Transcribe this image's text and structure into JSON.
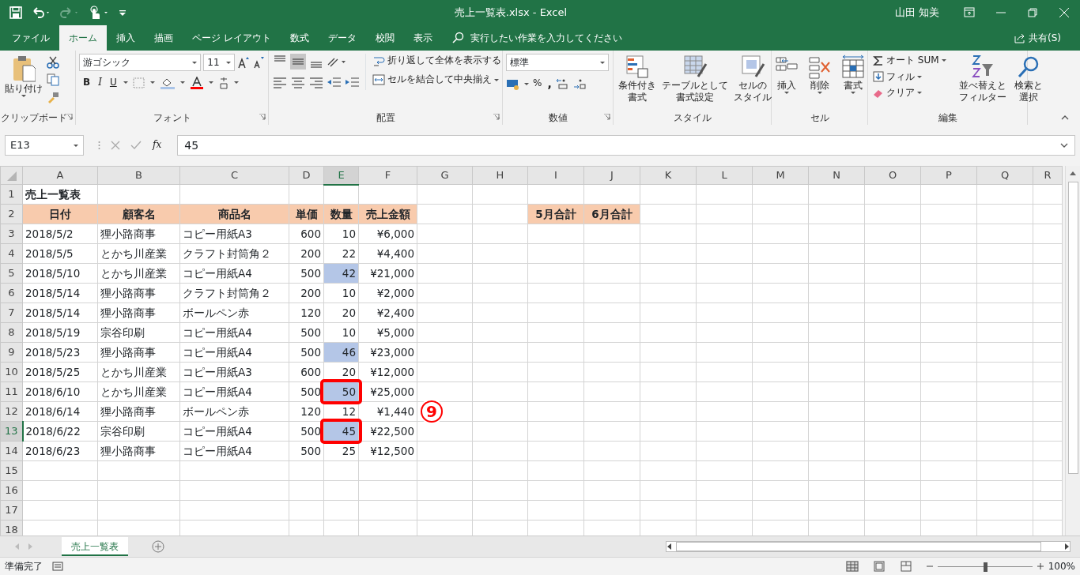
{
  "window": {
    "title": "売上一覧表.xlsx  -  Excel",
    "user": "山田 知美"
  },
  "menu_tabs": [
    {
      "label": "ファイル",
      "selected": false
    },
    {
      "label": "ホーム",
      "selected": true
    },
    {
      "label": "挿入",
      "selected": false
    },
    {
      "label": "描画",
      "selected": false
    },
    {
      "label": "ページ レイアウト",
      "selected": false
    },
    {
      "label": "数式",
      "selected": false
    },
    {
      "label": "データ",
      "selected": false
    },
    {
      "label": "校閲",
      "selected": false
    },
    {
      "label": "表示",
      "selected": false
    }
  ],
  "tell_me": {
    "placeholder": "実行したい作業を入力してください"
  },
  "share": "共有(S)",
  "ribbon": {
    "clipboard": {
      "paste": "貼り付け",
      "group": "クリップボード"
    },
    "font": {
      "name": "游ゴシック",
      "size": "11",
      "bold": "B",
      "italic": "I",
      "underline": "U",
      "group": "フォント"
    },
    "alignment": {
      "wrap": "折り返して全体を表示する",
      "merge": "セルを結合して中央揃え",
      "group": "配置"
    },
    "number": {
      "format": "標準",
      "percent": "%",
      "comma": ",",
      "group": "数値"
    },
    "styles": {
      "buttons": [
        [
          "条件付き",
          "書式"
        ],
        [
          "テーブルとして",
          "書式設定"
        ],
        [
          "セルの",
          "スタイル"
        ]
      ],
      "group": "スタイル"
    },
    "cells": {
      "buttons": [
        "挿入",
        "削除",
        "書式"
      ],
      "group": "セル"
    },
    "editing": {
      "autosum": "オート SUM",
      "fill": "フィル",
      "clear": "クリア",
      "sort": [
        "並べ替えと",
        "フィルター"
      ],
      "find": [
        "検索と",
        "選択"
      ],
      "group": "編集"
    }
  },
  "formula_bar": {
    "name_box": "E13",
    "fx": "fx",
    "formula": "45"
  },
  "columns": [
    {
      "label": "A",
      "selected": false
    },
    {
      "label": "B",
      "selected": false
    },
    {
      "label": "C",
      "selected": false
    },
    {
      "label": "D",
      "selected": false
    },
    {
      "label": "E",
      "selected": true
    },
    {
      "label": "F",
      "selected": false
    },
    {
      "label": "G",
      "selected": false
    },
    {
      "label": "H",
      "selected": false
    },
    {
      "label": "I",
      "selected": false
    },
    {
      "label": "J",
      "selected": false
    },
    {
      "label": "K",
      "selected": false
    },
    {
      "label": "L",
      "selected": false
    },
    {
      "label": "M",
      "selected": false
    },
    {
      "label": "N",
      "selected": false
    },
    {
      "label": "O",
      "selected": false
    },
    {
      "label": "P",
      "selected": false
    },
    {
      "label": "Q",
      "selected": false
    },
    {
      "label": "R",
      "selected": false
    }
  ],
  "row_numbers": [
    {
      "label": "1",
      "selected": false
    },
    {
      "label": "2",
      "selected": false
    },
    {
      "label": "3",
      "selected": false
    },
    {
      "label": "4",
      "selected": false
    },
    {
      "label": "5",
      "selected": false
    },
    {
      "label": "6",
      "selected": false
    },
    {
      "label": "7",
      "selected": false
    },
    {
      "label": "8",
      "selected": false
    },
    {
      "label": "9",
      "selected": false
    },
    {
      "label": "10",
      "selected": false
    },
    {
      "label": "11",
      "selected": false
    },
    {
      "label": "12",
      "selected": false
    },
    {
      "label": "13",
      "selected": true
    },
    {
      "label": "14",
      "selected": false
    },
    {
      "label": "15",
      "selected": false
    },
    {
      "label": "16",
      "selected": false
    },
    {
      "label": "17",
      "selected": false
    },
    {
      "label": "18",
      "selected": false
    }
  ],
  "sheet_title": "売上一覧表",
  "table": {
    "columns": [
      "日付",
      "顧客名",
      "商品名",
      "単価",
      "数量",
      "売上金額"
    ],
    "rows": [
      {
        "cells": [
          "2018/5/2",
          "狸小路商事",
          "コピー用紙A3",
          "600",
          "10",
          "¥6,000"
        ],
        "highlighted": false,
        "boxed": false
      },
      {
        "cells": [
          "2018/5/5",
          "とかち川産業",
          "クラフト封筒角２",
          "200",
          "22",
          "¥4,400"
        ],
        "highlighted": false,
        "boxed": false
      },
      {
        "cells": [
          "2018/5/10",
          "とかち川産業",
          "コピー用紙A4",
          "500",
          "42",
          "¥21,000"
        ],
        "highlighted": true,
        "boxed": false
      },
      {
        "cells": [
          "2018/5/14",
          "狸小路商事",
          "クラフト封筒角２",
          "200",
          "10",
          "¥2,000"
        ],
        "highlighted": false,
        "boxed": false
      },
      {
        "cells": [
          "2018/5/14",
          "狸小路商事",
          "ボールペン赤",
          "120",
          "20",
          "¥2,400"
        ],
        "highlighted": false,
        "boxed": false
      },
      {
        "cells": [
          "2018/5/19",
          "宗谷印刷",
          "コピー用紙A4",
          "500",
          "10",
          "¥5,000"
        ],
        "highlighted": false,
        "boxed": false
      },
      {
        "cells": [
          "2018/5/23",
          "狸小路商事",
          "コピー用紙A4",
          "500",
          "46",
          "¥23,000"
        ],
        "highlighted": true,
        "boxed": false
      },
      {
        "cells": [
          "2018/5/25",
          "とかち川産業",
          "コピー用紙A3",
          "600",
          "20",
          "¥12,000"
        ],
        "highlighted": false,
        "boxed": false
      },
      {
        "cells": [
          "2018/6/10",
          "とかち川産業",
          "コピー用紙A4",
          "500",
          "50",
          "¥25,000"
        ],
        "highlighted": true,
        "boxed": true
      },
      {
        "cells": [
          "2018/6/14",
          "狸小路商事",
          "ボールペン赤",
          "120",
          "12",
          "¥1,440"
        ],
        "highlighted": false,
        "boxed": false
      },
      {
        "cells": [
          "2018/6/22",
          "宗谷印刷",
          "コピー用紙A4",
          "500",
          "45",
          "¥22,500"
        ],
        "highlighted": true,
        "boxed": true
      },
      {
        "cells": [
          "2018/6/23",
          "狸小路商事",
          "コピー用紙A4",
          "500",
          "25",
          "¥12,500"
        ],
        "highlighted": false,
        "boxed": false
      }
    ]
  },
  "summary_headers": [
    "5月合計",
    "6月合計"
  ],
  "step_marker": {
    "label": "9"
  },
  "sheet_tabs": [
    {
      "label": "売上一覧表",
      "selected": true
    }
  ],
  "status_bar": {
    "status": "準備完了",
    "zoom_slider": {
      "level": 0.5
    },
    "zoom": "100%"
  }
}
